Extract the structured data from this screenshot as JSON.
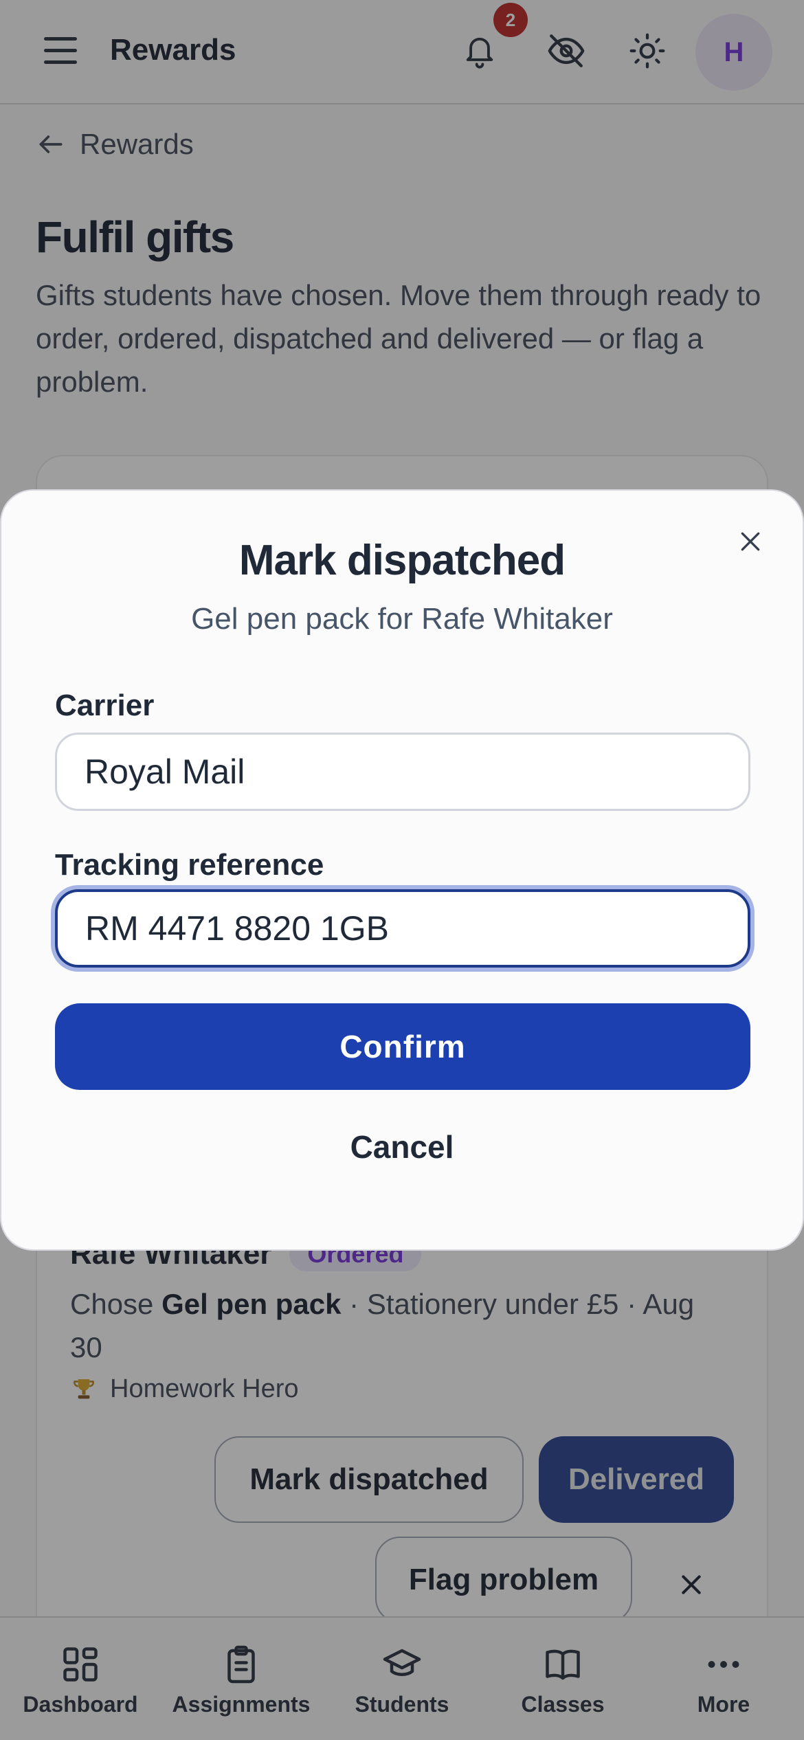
{
  "header": {
    "title": "Rewards",
    "notification_count": "2",
    "avatar_initial": "H"
  },
  "back_link": {
    "label": "Rewards"
  },
  "page": {
    "title": "Fulfil gifts",
    "description": "Gifts students have chosen. Move them through ready to order, ordered, dispatched and delivered — or flag a problem."
  },
  "gift_card": {
    "student_name": "Rafe Whitaker",
    "status": "Ordered",
    "chose_prefix": "Chose ",
    "gift_name": "Gel pen pack",
    "chose_suffix": " · Stationery under £5 · Aug 30",
    "award_icon": "trophy-icon",
    "award": "Homework Hero",
    "mark_dispatched_label": "Mark dispatched",
    "delivered_label": "Delivered",
    "flag_problem_label": "Flag problem"
  },
  "modal": {
    "title": "Mark dispatched",
    "subtitle": "Gel pen pack for Rafe Whitaker",
    "carrier_label": "Carrier",
    "carrier_value": "Royal Mail",
    "tracking_label": "Tracking reference",
    "tracking_value": "RM 4471 8820 1GB",
    "confirm_label": "Confirm",
    "cancel_label": "Cancel"
  },
  "bottom_nav": {
    "items": [
      {
        "label": "Dashboard",
        "icon": "grid-icon"
      },
      {
        "label": "Assignments",
        "icon": "clipboard-icon"
      },
      {
        "label": "Students",
        "icon": "graduation-cap-icon"
      },
      {
        "label": "Classes",
        "icon": "book-icon"
      },
      {
        "label": "More",
        "icon": "more-dots-icon"
      }
    ]
  },
  "colors": {
    "primary": "#1d40b0",
    "primary_dark": "#1e3a8a",
    "badge": "#b91c1c",
    "status_ordered": "#6d28d9"
  }
}
